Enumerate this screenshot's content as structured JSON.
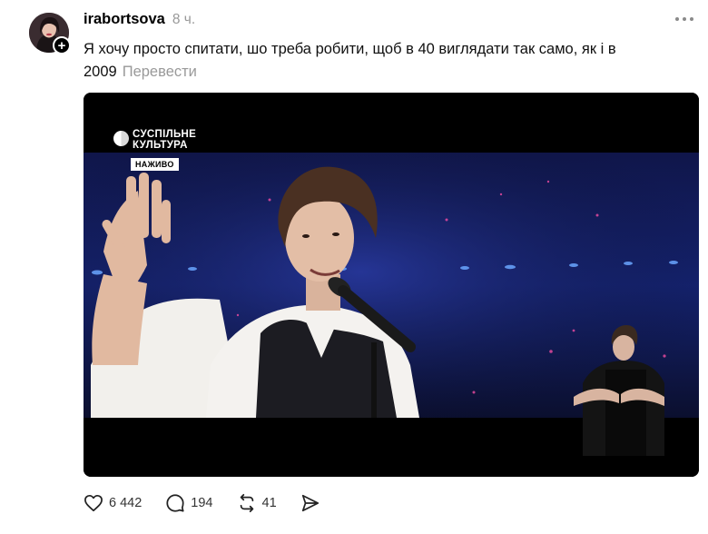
{
  "post": {
    "username": "irabortsova",
    "time": "8 ч.",
    "text": "Я хочу просто спитати, шо треба робити, щоб в 40 виглядати так само, як і в 2009",
    "translate_label": "Перевести",
    "follow_symbol": "+"
  },
  "video": {
    "channel_line1": "СУСПІЛЬНЕ",
    "channel_line2": "КУЛЬТУРА",
    "live_badge": "НАЖИВО"
  },
  "actions": {
    "likes": "6 442",
    "comments": "194",
    "reposts": "41"
  },
  "icons": {
    "like": "heart-icon",
    "comment": "comment-icon",
    "repost": "repost-icon",
    "share": "share-icon",
    "more": "more-dots-icon"
  }
}
